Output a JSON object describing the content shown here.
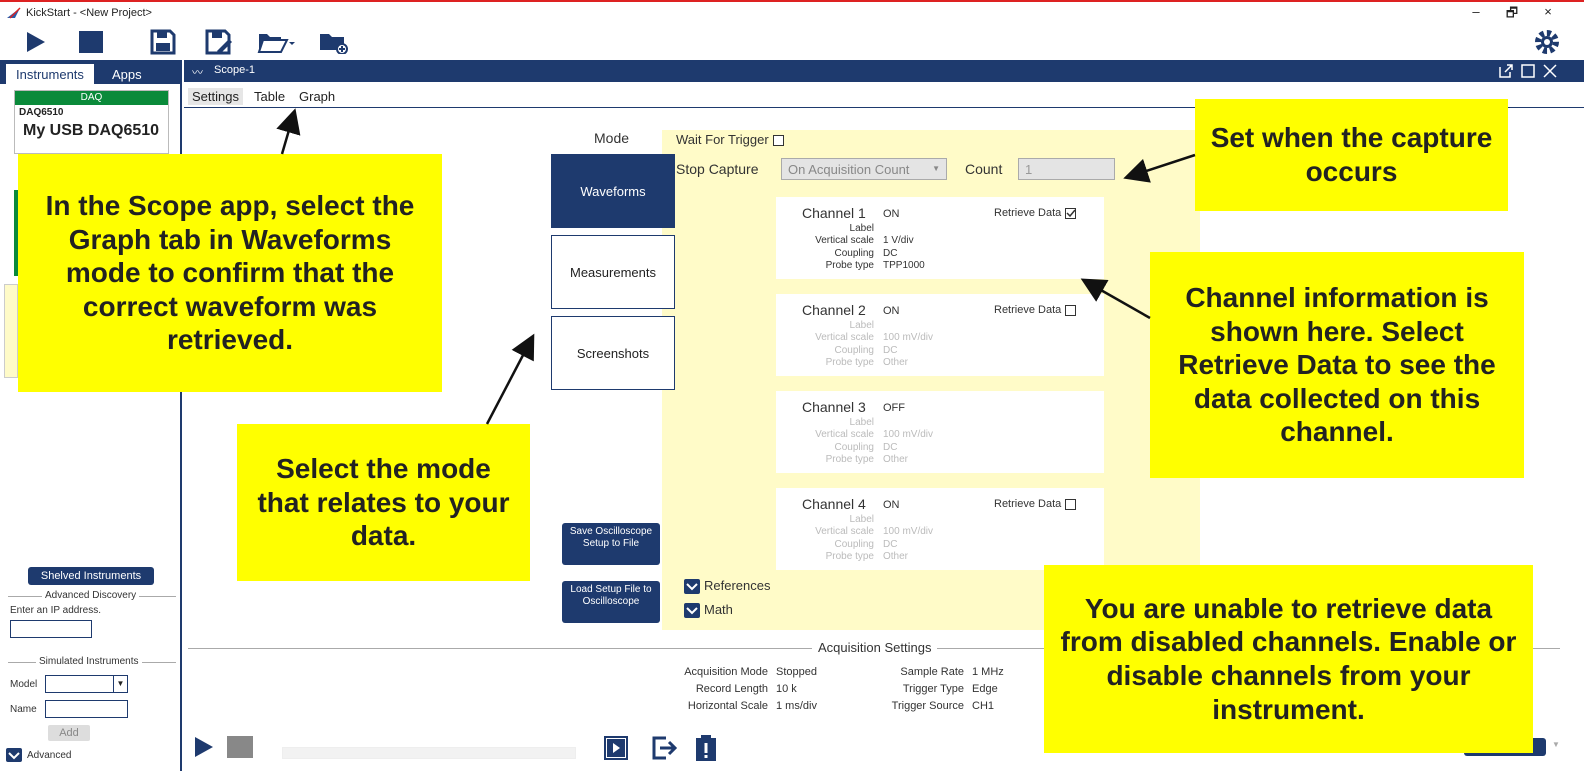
{
  "window": {
    "title": "KickStart - <New Project>",
    "minimize": "–",
    "restore": "🗗",
    "close": "×"
  },
  "toolbar": {
    "icons": [
      "play-icon",
      "stop-icon",
      "save-icon",
      "save-as-icon",
      "open-folder-icon",
      "new-folder-icon",
      "gear-icon"
    ]
  },
  "sidebar": {
    "tabs": [
      "Instruments",
      "Apps"
    ],
    "instrument": {
      "header": "DAQ",
      "model": "DAQ6510",
      "name": "My USB DAQ6510"
    },
    "shelved_button": "Shelved Instruments",
    "advanced_discovery": "Advanced Discovery",
    "ip_prompt": "Enter an IP address.",
    "simulated": "Simulated Instruments",
    "model_label": "Model",
    "name_label": "Name",
    "add_button": "Add",
    "advanced": "Advanced"
  },
  "scope": {
    "title": "Scope-1",
    "tabs": [
      "Settings",
      "Table",
      "Graph"
    ],
    "mode_label": "Mode",
    "modes": [
      "Waveforms",
      "Measurements",
      "Screenshots"
    ],
    "wait_for_trigger": "Wait For Trigger",
    "stop_capture_label": "Stop Capture",
    "stop_capture_value": "On Acquisition Count",
    "count_label": "Count",
    "count_value": "1",
    "retrieve_label": "Retrieve Data",
    "field_keys": [
      "Label",
      "Vertical scale",
      "Coupling",
      "Probe type"
    ],
    "channels": [
      {
        "name": "Channel 1",
        "state": "ON",
        "retrieve": true,
        "values": [
          "",
          "1 V/div",
          "DC",
          "TPP1000"
        ]
      },
      {
        "name": "Channel 2",
        "state": "ON",
        "retrieve": false,
        "values": [
          "",
          "100 mV/div",
          "DC",
          "Other"
        ]
      },
      {
        "name": "Channel 3",
        "state": "OFF",
        "retrieve": null,
        "values": [
          "",
          "100 mV/div",
          "DC",
          "Other"
        ]
      },
      {
        "name": "Channel 4",
        "state": "ON",
        "retrieve": false,
        "values": [
          "",
          "100 mV/div",
          "DC",
          "Other"
        ]
      }
    ],
    "save_button": "Save Oscilloscope Setup to File",
    "load_button": "Load Setup File to Oscilloscope",
    "references": "References",
    "math": "Math",
    "acquisition_settings": "Acquisition Settings",
    "acquisition": {
      "mode_key": "Acquisition Mode",
      "mode_val": "Stopped",
      "record_key": "Record Length",
      "record_val": "10 k",
      "hscale_key": "Horizontal Scale",
      "hscale_val": "1 ms/div",
      "rate_key": "Sample Rate",
      "rate_val": "1 MHz",
      "trigtype_key": "Trigger Type",
      "trigtype_val": "Edge",
      "trigsrc_key": "Trigger Source",
      "trigsrc_val": "CH1"
    }
  },
  "callouts": {
    "graph_tab": "In the Scope app, select the Graph tab in Waveforms mode to confirm that the correct waveform was retrieved.",
    "mode": "Select the mode that relates to your data.",
    "capture": "Set when the capture occurs",
    "channel": "Channel information is shown here. Select Retrieve Data to see the data collected on this channel.",
    "disabled": "You are unable to retrieve data from disabled channels. Enable or disable channels from your instrument."
  },
  "colors": {
    "navy": "#1e3a6e",
    "callout": "#ffff00",
    "panel": "#fffbc8",
    "accent_red": "#d22"
  }
}
